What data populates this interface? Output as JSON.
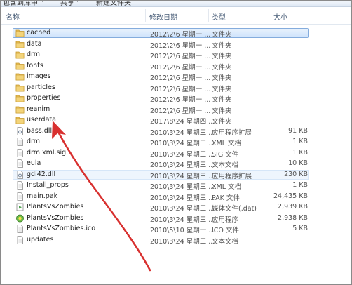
{
  "toolbar": {
    "include_library": "包含到库中",
    "share": "共享",
    "new_folder": "新建文件夹"
  },
  "columns": {
    "name": "名称",
    "date": "修改日期",
    "type": "类型",
    "size": "大小"
  },
  "files": [
    {
      "name": "cached",
      "date": "2012\\2\\6 星期一 ...",
      "type": "文件夹",
      "size": "",
      "icon": "folder-icon",
      "selected": true
    },
    {
      "name": "data",
      "date": "2012\\2\\6 星期一 ...",
      "type": "文件夹",
      "size": "",
      "icon": "folder-icon"
    },
    {
      "name": "drm",
      "date": "2012\\2\\6 星期一 ...",
      "type": "文件夹",
      "size": "",
      "icon": "folder-icon"
    },
    {
      "name": "fonts",
      "date": "2012\\2\\6 星期一 ...",
      "type": "文件夹",
      "size": "",
      "icon": "folder-icon"
    },
    {
      "name": "images",
      "date": "2012\\2\\6 星期一 ...",
      "type": "文件夹",
      "size": "",
      "icon": "folder-icon"
    },
    {
      "name": "particles",
      "date": "2012\\2\\6 星期一 ...",
      "type": "文件夹",
      "size": "",
      "icon": "folder-icon"
    },
    {
      "name": "properties",
      "date": "2012\\2\\6 星期一 ...",
      "type": "文件夹",
      "size": "",
      "icon": "folder-icon"
    },
    {
      "name": "reanim",
      "date": "2012\\2\\6 星期一 ...",
      "type": "文件夹",
      "size": "",
      "icon": "folder-icon"
    },
    {
      "name": "userdata",
      "date": "2017\\8\\24 星期四 ...",
      "type": "文件夹",
      "size": "",
      "icon": "folder-icon"
    },
    {
      "name": "bass.dll",
      "date": "2010\\3\\24 星期三 ...",
      "type": "应用程序扩展",
      "size": "91 KB",
      "icon": "dll-icon"
    },
    {
      "name": "drm",
      "date": "2010\\3\\24 星期三 ...",
      "type": "XML 文档",
      "size": "1 KB",
      "icon": "document-icon"
    },
    {
      "name": "drm.xml.sig",
      "date": "2010\\3\\24 星期三 ...",
      "type": "SIG 文件",
      "size": "1 KB",
      "icon": "document-icon"
    },
    {
      "name": "eula",
      "date": "2010\\3\\24 星期三 ...",
      "type": "文本文档",
      "size": "10 KB",
      "icon": "document-icon"
    },
    {
      "name": "gdi42.dll",
      "date": "2010\\3\\24 星期三 ...",
      "type": "应用程序扩展",
      "size": "230 KB",
      "icon": "dll-icon",
      "hover": true
    },
    {
      "name": "Install_props",
      "date": "2010\\3\\24 星期三 ...",
      "type": "XML 文档",
      "size": "1 KB",
      "icon": "document-icon"
    },
    {
      "name": "main.pak",
      "date": "2010\\3\\24 星期三 ...",
      "type": "PAK 文件",
      "size": "24,435 KB",
      "icon": "document-icon"
    },
    {
      "name": "PlantsVsZombies",
      "date": "2010\\3\\24 星期三 ...",
      "type": "媒体文件(.dat)",
      "size": "2,939 KB",
      "icon": "media-icon"
    },
    {
      "name": "PlantsVsZombies",
      "date": "2010\\3\\24 星期三 ...",
      "type": "应用程序",
      "size": "2,938 KB",
      "icon": "app-icon"
    },
    {
      "name": "PlantsVsZombies.ico",
      "date": "2010\\5\\10 星期一 ...",
      "type": "ICO 文件",
      "size": "5 KB",
      "icon": "document-icon"
    },
    {
      "name": "updates",
      "date": "2010\\3\\24 星期三 ...",
      "type": "文本文档",
      "size": "",
      "icon": "document-icon"
    }
  ],
  "colors": {
    "selection_border": "#84acdd",
    "selection_fill": "#cfe3fb",
    "folder": "#e8c05a",
    "arrow": "#d8302f"
  }
}
